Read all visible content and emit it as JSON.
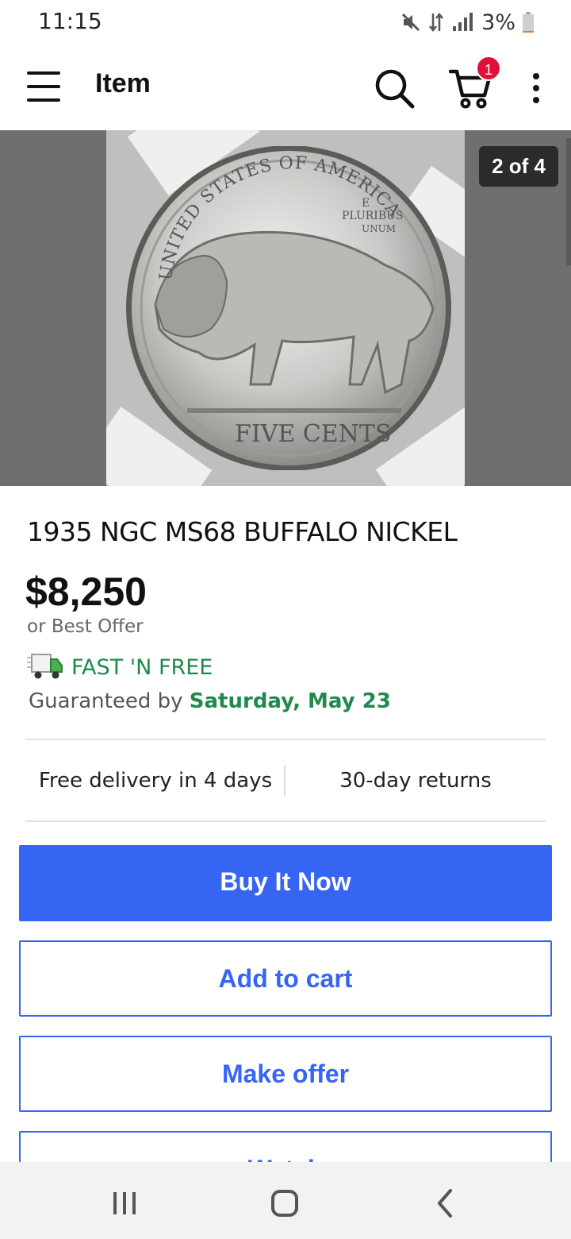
{
  "status_bar": {
    "time": "11:15",
    "battery": "3%"
  },
  "app_bar": {
    "title": "Item",
    "cart_count": "1"
  },
  "gallery": {
    "indicator": "2 of 4",
    "coin_legend_top": "UNITED STATES OF AMERICA",
    "coin_motto_1": "E",
    "coin_motto_2": "PLURIBUS",
    "coin_motto_3": "UNUM",
    "coin_denomination": "FIVE CENTS"
  },
  "item": {
    "title": "1935 NGC MS68 BUFFALO NICKEL",
    "price": "$8,250",
    "price_note": "or Best Offer",
    "shipping_label": "FAST 'N FREE",
    "guarantee_prefix": "Guaranteed by ",
    "guarantee_date": "Saturday, May 23",
    "feature_left": "Free delivery in 4 days",
    "feature_right": "30-day returns"
  },
  "actions": {
    "buy_now": "Buy It Now",
    "add_to_cart": "Add to cart",
    "make_offer": "Make offer",
    "watch": "Watch"
  },
  "colors": {
    "primary_blue": "#3665f3",
    "fast_free_green": "#1f8a4c",
    "badge_red": "#e0103a"
  }
}
